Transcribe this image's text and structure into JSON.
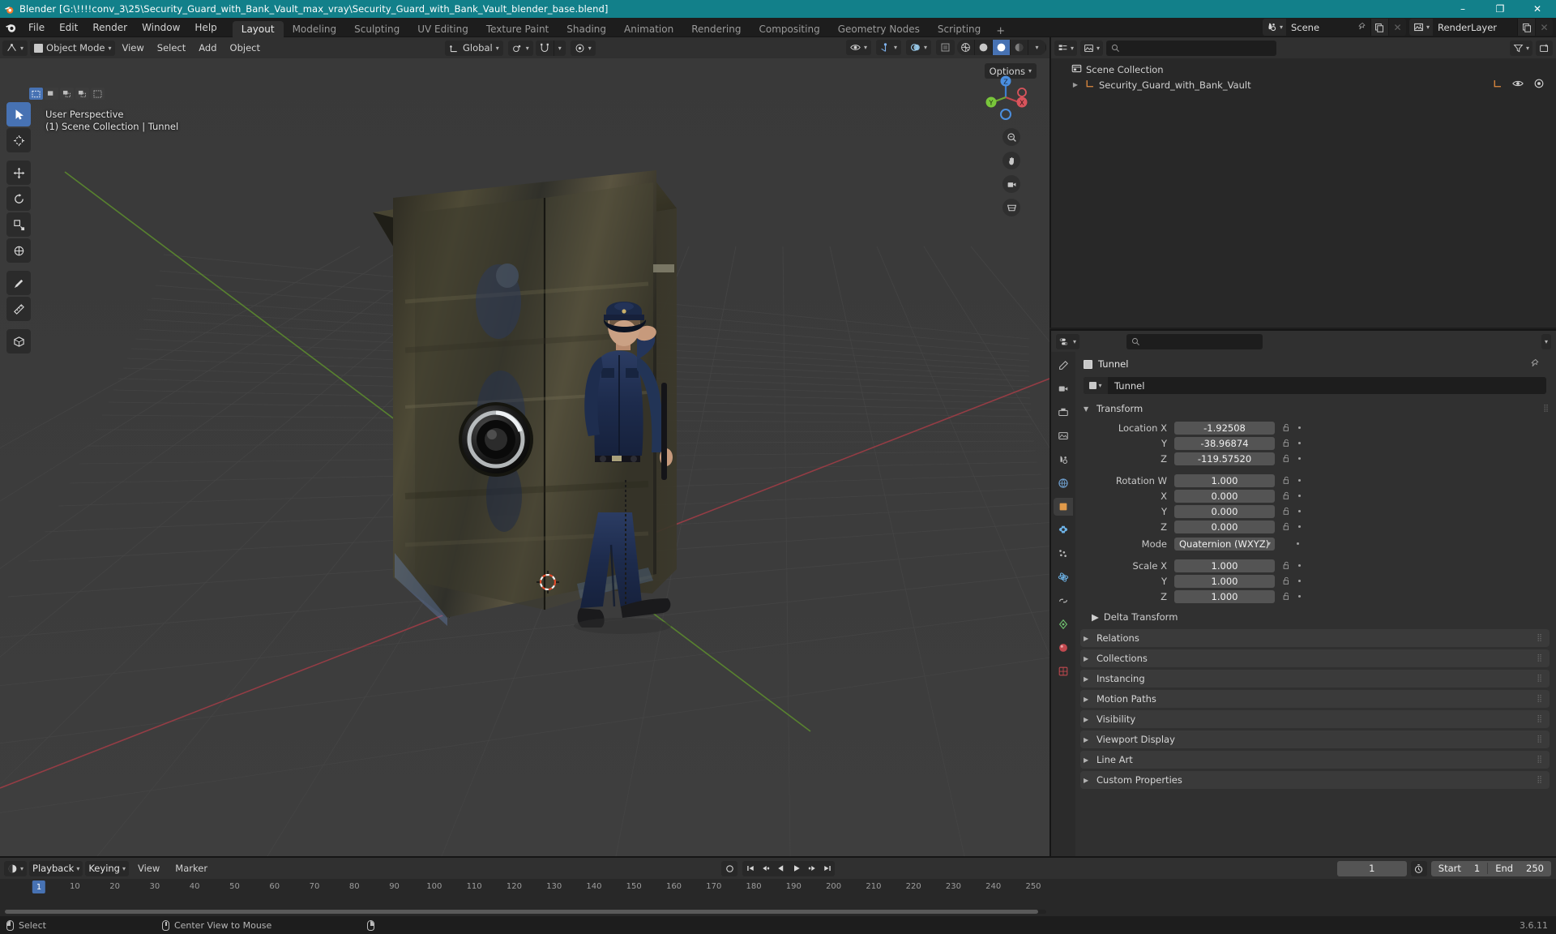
{
  "window": {
    "title": "Blender [G:\\!!!!conv_3\\25\\Security_Guard_with_Bank_Vault_max_vray\\Security_Guard_with_Bank_Vault_blender_base.blend]",
    "minimize": "–",
    "maximize": "❐",
    "close": "✕",
    "version": "3.6.11"
  },
  "menus": [
    "File",
    "Edit",
    "Render",
    "Window",
    "Help"
  ],
  "workspaces": {
    "tabs": [
      "Layout",
      "Modeling",
      "Sculpting",
      "UV Editing",
      "Texture Paint",
      "Shading",
      "Animation",
      "Rendering",
      "Compositing",
      "Geometry Nodes",
      "Scripting"
    ],
    "active": "Layout",
    "add": "+"
  },
  "topbar_fields": {
    "scene_label": "Scene",
    "viewlayer_label": "RenderLayer"
  },
  "viewport": {
    "mode": "Object Mode",
    "menus": [
      "View",
      "Select",
      "Add",
      "Object"
    ],
    "transform_orientation": "Global",
    "options_label": "Options",
    "overlay_line1": "User Perspective",
    "overlay_line2": "(1) Scene Collection | Tunnel",
    "gizmo_axes": {
      "x": "X",
      "y": "Y",
      "z": "Z"
    },
    "tools": [
      "tweak-tool",
      "cursor-tool",
      "move-tool",
      "rotate-tool",
      "scale-tool",
      "transform-tool",
      "annotate-tool",
      "measure-tool",
      "add-cube-tool"
    ]
  },
  "outliner": {
    "search_placeholder": "",
    "items": [
      {
        "label": "Scene Collection",
        "icon": "collection-icon",
        "depth": 0,
        "expandable": false
      },
      {
        "label": "Security_Guard_with_Bank_Vault",
        "icon": "empty-axis-icon",
        "depth": 1,
        "expandable": true
      }
    ]
  },
  "properties": {
    "search_placeholder": "",
    "object_name": "Tunnel",
    "object_field_value": "Tunnel",
    "panels": [
      {
        "label": "Transform",
        "open": true
      },
      {
        "label": "Delta Transform",
        "open": false
      },
      {
        "label": "Relations",
        "open": false
      },
      {
        "label": "Collections",
        "open": false
      },
      {
        "label": "Instancing",
        "open": false
      },
      {
        "label": "Motion Paths",
        "open": false
      },
      {
        "label": "Visibility",
        "open": false
      },
      {
        "label": "Viewport Display",
        "open": false
      },
      {
        "label": "Line Art",
        "open": false
      },
      {
        "label": "Custom Properties",
        "open": false
      }
    ],
    "transform": {
      "location": [
        {
          "label": "Location X",
          "value": "-1.92508"
        },
        {
          "label": "Y",
          "value": "-38.96874"
        },
        {
          "label": "Z",
          "value": "-119.57520"
        }
      ],
      "rotation": [
        {
          "label": "Rotation W",
          "value": "1.000"
        },
        {
          "label": "X",
          "value": "0.000"
        },
        {
          "label": "Y",
          "value": "0.000"
        },
        {
          "label": "Z",
          "value": "0.000"
        }
      ],
      "mode_label": "Mode",
      "mode_value": "Quaternion (WXYZ)",
      "scale": [
        {
          "label": "Scale X",
          "value": "1.000"
        },
        {
          "label": "Y",
          "value": "1.000"
        },
        {
          "label": "Z",
          "value": "1.000"
        }
      ]
    }
  },
  "timeline": {
    "menus": [
      "Playback",
      "Keying",
      "View",
      "Marker"
    ],
    "current_frame": "1",
    "start_label": "Start",
    "start_value": "1",
    "end_label": "End",
    "end_value": "250",
    "ticks": [
      "10",
      "20",
      "30",
      "40",
      "50",
      "60",
      "70",
      "80",
      "90",
      "100",
      "110",
      "120",
      "130",
      "140",
      "150",
      "160",
      "170",
      "180",
      "190",
      "200",
      "210",
      "220",
      "230",
      "240",
      "250"
    ],
    "playhead_label": "1"
  },
  "statusbar": {
    "select_label": "Select",
    "center_view_label": "Center View to Mouse",
    "version": "3.6.11"
  },
  "colors": {
    "title_bar": "#12808a",
    "accent": "#4772b3",
    "axis_x": "#b34a50",
    "axis_y": "#6fa832",
    "bg_viewport": "#393939"
  }
}
